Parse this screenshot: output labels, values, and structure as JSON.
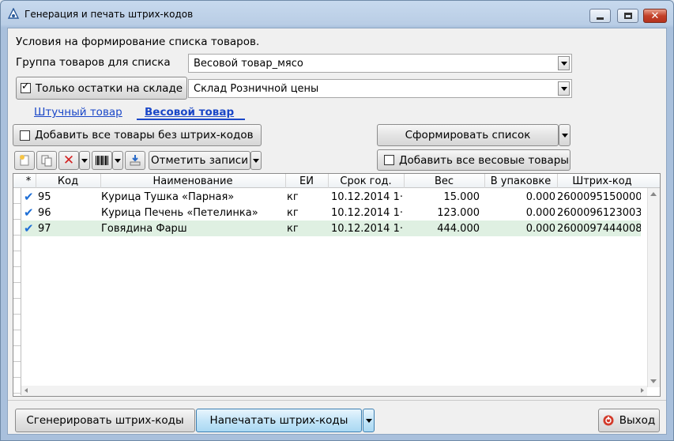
{
  "window": {
    "title": "Генерация и печать штрих-кодов"
  },
  "form": {
    "conditions_label": "Условия на формирование списка товаров.",
    "group_label": "Группа товаров для списка",
    "group_value": "Весовой товар_мясо",
    "only_stock_label": "Только остатки на складе",
    "only_stock_checked": true,
    "warehouse_value": "Склад Розничной цены"
  },
  "tabs": [
    {
      "label": "Штучный товар",
      "active": false
    },
    {
      "label": "Весовой товар",
      "active": true
    }
  ],
  "actions": {
    "add_no_barcode_label": "Добавить все товары без штрих-кодов",
    "form_list_label": "Сформировать список",
    "mark_records_label": "Отметить записи",
    "add_weight_label": "Добавить все весовые товары"
  },
  "grid": {
    "columns": [
      "*",
      "Код",
      "Наименование",
      "ЕИ",
      "Срок год.",
      "Вес",
      "В упаковке",
      "Штрих-код"
    ],
    "rows": [
      {
        "checked": true,
        "code": "95",
        "name": "Курица Тушка  «Парная»",
        "unit": "кг",
        "expiry": "10.12.2014 1·",
        "weight": "15.000",
        "pack": "0.000",
        "barcode": "2600095150000",
        "selected": false
      },
      {
        "checked": true,
        "code": "96",
        "name": "Курица Печень  «Петелинка»",
        "unit": "кг",
        "expiry": "10.12.2014 1·",
        "weight": "123.000",
        "pack": "0.000",
        "barcode": "2600096123003",
        "selected": false
      },
      {
        "checked": true,
        "code": "97",
        "name": "Говядина Фарш",
        "unit": "кг",
        "expiry": "10.12.2014 1·",
        "weight": "444.000",
        "pack": "0.000",
        "barcode": "2600097444008",
        "selected": true
      }
    ]
  },
  "footer": {
    "generate_label": "Сгенерировать штрих-коды",
    "print_label": "Напечатать штрих-коды",
    "exit_label": "Выход"
  },
  "colors": {
    "accent": "#1a47c8",
    "selected_row": "#dff0e2",
    "check": "#1f6fd6"
  }
}
